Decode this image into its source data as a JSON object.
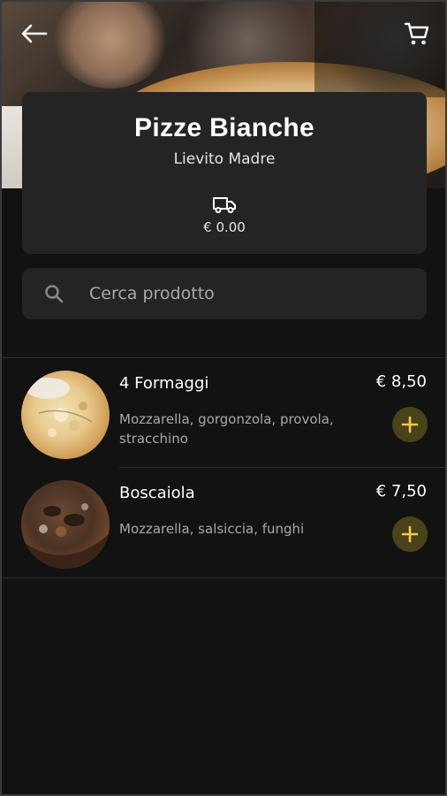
{
  "header": {
    "back_icon": "arrow-left-icon",
    "cart_icon": "cart-icon"
  },
  "category": {
    "title": "Pizze Bianche",
    "subtitle": "Lievito Madre",
    "delivery_icon": "truck-icon",
    "delivery_fee": "€ 0.00"
  },
  "search": {
    "placeholder": "Cerca prodotto",
    "value": ""
  },
  "colors": {
    "background": "#121212",
    "card": "#242424",
    "accent": "#f2c94c",
    "add_button_bg": "#4a4218",
    "muted_text": "#a8a8a8"
  },
  "products": [
    {
      "name": "4 Formaggi",
      "price": "€ 8,50",
      "description": "Mozzarella, gorgonzola, provola, stracchino"
    },
    {
      "name": "Boscaiola",
      "price": "€ 7,50",
      "description": "Mozzarella, salsiccia, funghi"
    }
  ]
}
